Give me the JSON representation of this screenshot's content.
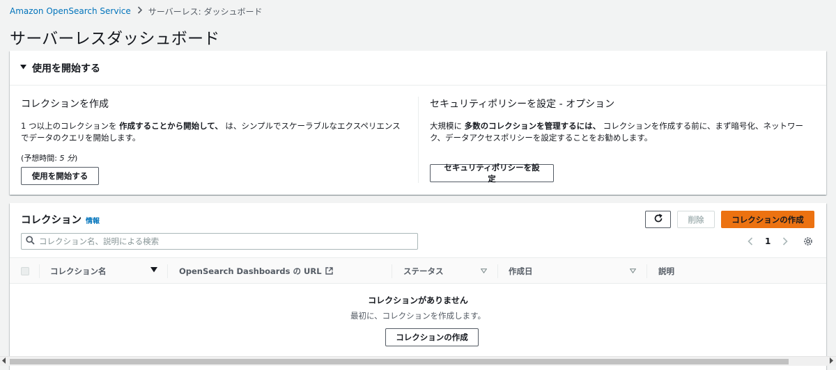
{
  "breadcrumb": {
    "root": "Amazon OpenSearch Service",
    "current": "サーバーレス: ダッシュボード"
  },
  "page_title": "サーバーレスダッシュボード",
  "getting_started": {
    "header": "使用を開始する",
    "create": {
      "title": "コレクションを作成",
      "desc_pre": "1 つ以上のコレクションを ",
      "desc_bold": "作成することから開始して、",
      "desc_post": " は、シンプルでスケーラブルなエクスペリエンスでデータのクエリを開始します。",
      "time_label": "(予想時間: ",
      "time_value": "5 分",
      "time_close": ")",
      "button": "使用を開始する"
    },
    "security": {
      "title": "セキュリティポリシーを設定 - オプション",
      "desc_pre": "大規模に ",
      "desc_bold": "多数のコレクションを管理するには、",
      "desc_post": " コレクションを作成する前に、まず暗号化、ネットワーク、データアクセスポリシーを設定することをお勧めします。",
      "button": "セキュリティポリシーを設定"
    }
  },
  "collections": {
    "title": "コレクション",
    "info": "情報",
    "delete_label": "削除",
    "create_label": "コレクションの作成",
    "search_placeholder": "コレクション名、説明による検索",
    "page": "1",
    "columns": {
      "name": "コレクション名",
      "url": "OpenSearch Dashboards の URL",
      "status": "ステータス",
      "created": "作成日",
      "desc": "説明"
    },
    "empty_title": "コレクションがありません",
    "empty_sub": "最初に、コレクションを作成します。",
    "empty_button": "コレクションの作成"
  },
  "icons": {
    "caret": "caret-down-icon",
    "refresh": "refresh-icon",
    "search": "search-icon",
    "settings": "gear-icon",
    "external": "external-link-icon"
  },
  "colors": {
    "accent": "#ec7211",
    "link": "#0073bb"
  }
}
